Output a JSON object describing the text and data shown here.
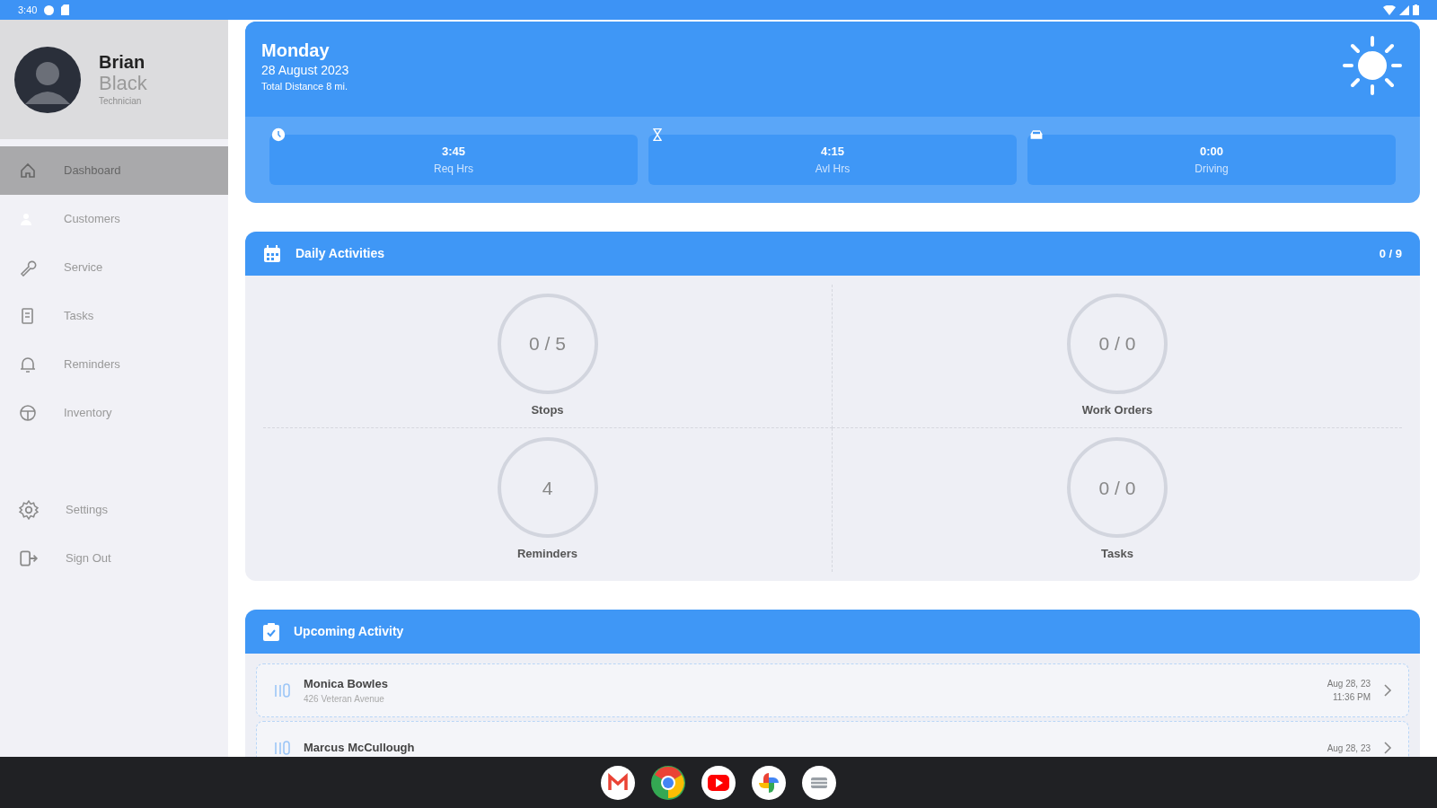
{
  "status_bar": {
    "time": "3:40"
  },
  "profile": {
    "first_name": "Brian",
    "last_name": "Black",
    "role": "Technician"
  },
  "sidebar": {
    "items": [
      {
        "label": "Dashboard",
        "selected": true
      },
      {
        "label": "Customers",
        "selected": false
      },
      {
        "label": "Service",
        "selected": false
      },
      {
        "label": "Tasks",
        "selected": false
      },
      {
        "label": "Reminders",
        "selected": false
      },
      {
        "label": "Inventory",
        "selected": false
      }
    ],
    "footer_items": [
      {
        "label": "Settings"
      },
      {
        "label": "Sign Out"
      }
    ]
  },
  "day_card": {
    "day": "Monday",
    "date": "28 August 2023",
    "distance": "Total Distance 8 mi.",
    "stats": [
      {
        "value": "3:45",
        "label": "Req Hrs"
      },
      {
        "value": "4:15",
        "label": "Avl Hrs"
      },
      {
        "value": "0:00",
        "label": "Driving"
      }
    ]
  },
  "daily_activities": {
    "title": "Daily Activities",
    "count": "0 / 9",
    "items": [
      {
        "value": "0 / 5",
        "label": "Stops"
      },
      {
        "value": "0 / 0",
        "label": "Work Orders"
      },
      {
        "value": "4",
        "label": "Reminders"
      },
      {
        "value": "0 / 0",
        "label": "Tasks"
      }
    ]
  },
  "upcoming_activity": {
    "title": "Upcoming Activity",
    "rows": [
      {
        "name": "Monica Bowles",
        "address": "426 Veteran Avenue",
        "date": "Aug 28, 23",
        "time": "11:36 PM"
      },
      {
        "name": "Marcus McCullough",
        "date": "Aug 28, 23"
      }
    ]
  }
}
